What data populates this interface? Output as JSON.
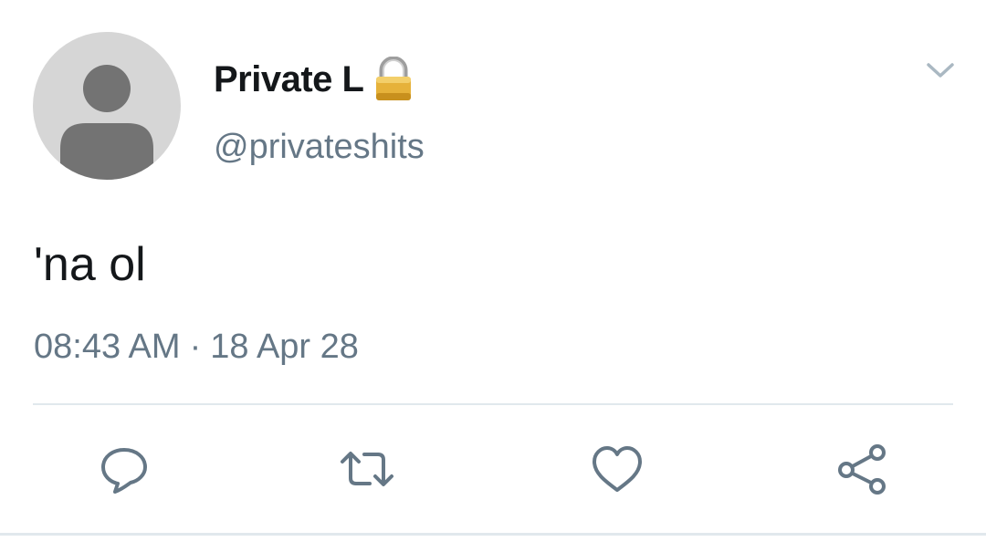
{
  "tweet": {
    "display_name": "Private L",
    "handle": "@privateshits",
    "text": "'na ol",
    "time": "08:43 AM",
    "separator": "·",
    "date": "18 Apr 28"
  },
  "icons": {
    "avatar": "default-avatar-icon",
    "lock": "lock-icon",
    "menu": "chevron-down-icon",
    "reply": "reply-icon",
    "retweet": "retweet-icon",
    "like": "heart-icon",
    "share": "share-icon"
  },
  "colors": {
    "text": "#14171a",
    "secondary": "#657786",
    "divider": "#e1e8ed",
    "avatar_bg": "#d6d6d6",
    "avatar_fg": "#737373"
  }
}
